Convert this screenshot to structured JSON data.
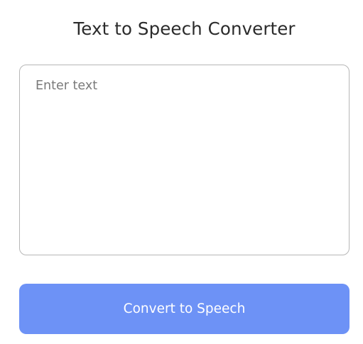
{
  "app": {
    "title": "Text to Speech Converter"
  },
  "input": {
    "placeholder": "Enter text",
    "value": ""
  },
  "actions": {
    "convert_label": "Convert to Speech"
  },
  "colors": {
    "accent": "#6d92f6",
    "title_text": "#2b2b2b",
    "input_border": "#b7b7b7",
    "placeholder_text": "#7a7a7a",
    "button_text": "#ffffff",
    "background": "#ffffff"
  }
}
